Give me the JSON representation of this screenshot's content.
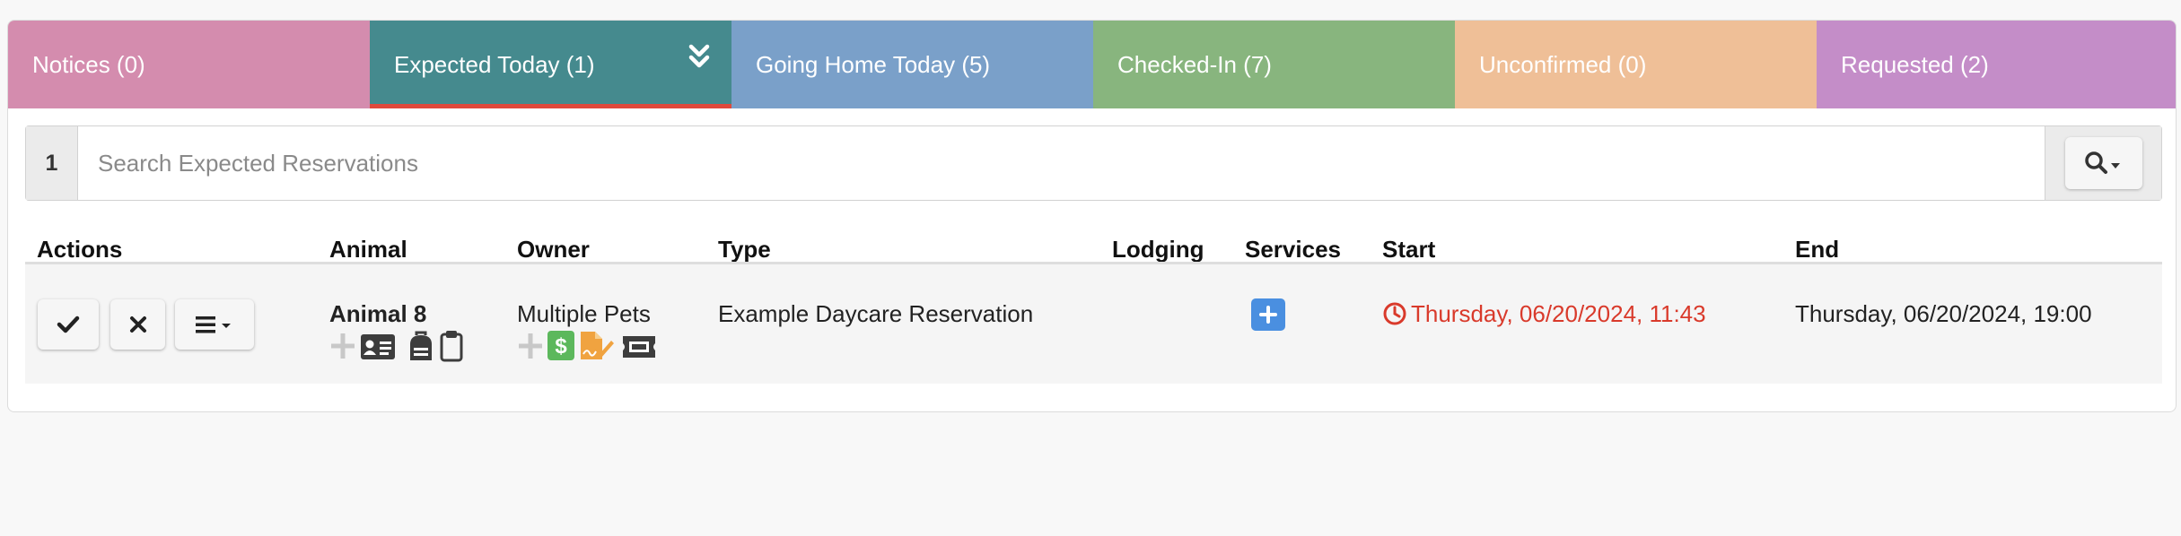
{
  "colors": {
    "notices": "#d48cae",
    "expected_today": "#458a8e",
    "going_home_today": "#7aa0c9",
    "checked_in": "#88b57e",
    "unconfirmed": "#efbf97",
    "requested": "#c48dc8",
    "active_underline": "#e0493c",
    "start_time_red": "#d93a2b",
    "services_blue": "#4a8fe0"
  },
  "tabs": [
    {
      "label": "Notices (0)",
      "active": false
    },
    {
      "label": "Expected Today (1)",
      "active": true,
      "icon": "double-chevron-down-icon"
    },
    {
      "label": "Going Home Today (5)",
      "active": false
    },
    {
      "label": "Checked-In (7)",
      "active": false
    },
    {
      "label": "Unconfirmed (0)",
      "active": false
    },
    {
      "label": "Requested (2)",
      "active": false
    }
  ],
  "search": {
    "count": "1",
    "placeholder": "Search Expected Reservations",
    "value": "",
    "button_icon": "search-dropdown-icon"
  },
  "table": {
    "headers": {
      "actions": "Actions",
      "animal": "Animal",
      "owner": "Owner",
      "type": "Type",
      "lodging": "Lodging",
      "services": "Services",
      "start": "Start",
      "end": "End"
    },
    "rows": [
      {
        "action_icons": [
          "check-icon",
          "close-icon",
          "menu-dropdown-icon"
        ],
        "animal": "Animal 8",
        "animal_icons": [
          "plus-icon",
          "id-card-icon",
          "backpack-icon",
          "clipboard-icon"
        ],
        "owner": "Multiple Pets",
        "owner_icons": [
          "plus-icon",
          "dollar-icon",
          "signature-file-icon",
          "ticket-icon"
        ],
        "type": "Example Daycare Reservation",
        "lodging": "",
        "services_icon": "add-service-icon",
        "start": "Thursday, 06/20/2024, 11:43",
        "start_icon": "clock-icon",
        "end": "Thursday, 06/20/2024, 19:00"
      }
    ]
  }
}
